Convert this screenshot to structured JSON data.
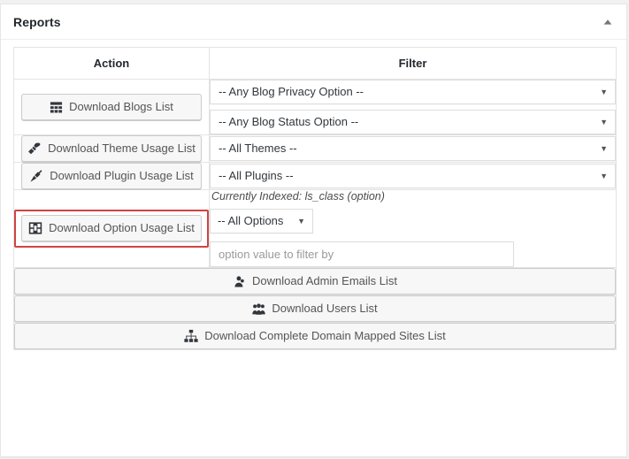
{
  "panel": {
    "title": "Reports",
    "toggle_icon": "chevron-up-icon"
  },
  "table": {
    "headers": {
      "action": "Action",
      "filter": "Filter"
    },
    "rows": [
      {
        "id": "blogs",
        "button": {
          "label": "Download Blogs List",
          "icon": "dashboard-grid-icon"
        },
        "filters": [
          {
            "type": "select",
            "value": "-- Any Blog Privacy Option --"
          },
          {
            "type": "select",
            "value": "-- Any Blog Status Option --"
          }
        ]
      },
      {
        "id": "theme-usage",
        "button": {
          "label": "Download Theme Usage List",
          "icon": "paintbrush-icon"
        },
        "filters": [
          {
            "type": "select",
            "value": "-- All Themes --"
          }
        ]
      },
      {
        "id": "plugin-usage",
        "button": {
          "label": "Download Plugin Usage List",
          "icon": "plug-icon"
        },
        "filters": [
          {
            "type": "select",
            "value": "-- All Plugins --"
          }
        ]
      },
      {
        "id": "option-usage",
        "highlighted": true,
        "highlight_color": "#cf4343",
        "button": {
          "label": "Download Option Usage List",
          "icon": "layout-columns-icon"
        },
        "note": "Currently Indexed: ls_class (option)",
        "filters": [
          {
            "type": "select",
            "value": "-- All Options"
          },
          {
            "type": "text",
            "value": "",
            "placeholder": "option value to filter by"
          }
        ]
      }
    ],
    "full_width_rows": [
      {
        "id": "admin-emails",
        "label": "Download Admin Emails List",
        "icon": "admin-user-icon"
      },
      {
        "id": "users",
        "label": "Download Users List",
        "icon": "groups-icon"
      },
      {
        "id": "domain-mapped-sites",
        "label": "Download Complete Domain Mapped Sites List",
        "icon": "sitemap-icon"
      }
    ]
  }
}
